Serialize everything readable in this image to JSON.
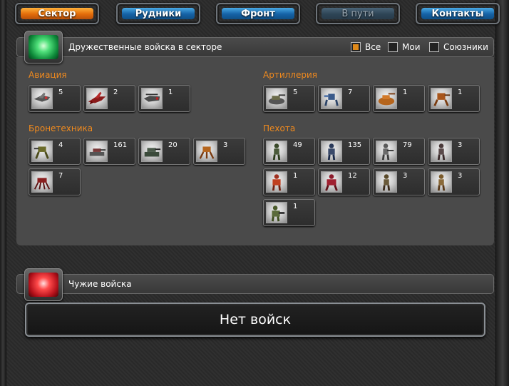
{
  "tabs": [
    {
      "label": "Сектор",
      "state": "active"
    },
    {
      "label": "Рудники",
      "state": "normal"
    },
    {
      "label": "Фронт",
      "state": "normal"
    },
    {
      "label": "В пути",
      "state": "disabled"
    },
    {
      "label": "Контакты",
      "state": "normal"
    }
  ],
  "friendly": {
    "title": "Дружественные войска в секторе",
    "filters": [
      {
        "label": "Все",
        "checked": true
      },
      {
        "label": "Мои",
        "checked": false
      },
      {
        "label": "Союзники",
        "checked": false
      }
    ],
    "groups": {
      "aviation": {
        "title": "Авиация",
        "counts": [
          "5",
          "2",
          "1"
        ]
      },
      "artillery": {
        "title": "Артиллерия",
        "counts": [
          "5",
          "7",
          "1",
          "1"
        ]
      },
      "armor": {
        "title": "Бронетехника",
        "counts": [
          "4",
          "161",
          "20",
          "3",
          "7"
        ]
      },
      "infantry": {
        "title": "Пехота",
        "counts": [
          "49",
          "135",
          "79",
          "3",
          "1",
          "12",
          "3",
          "3",
          "1"
        ]
      }
    }
  },
  "enemy": {
    "title": "Чужие войска",
    "empty_text": "Нет войск"
  },
  "colors": {
    "active_tab": "#e36c0a",
    "tab": "#1562a6",
    "group_title": "#f08a1e",
    "friendly_gem": "#2fcf5f",
    "enemy_gem": "#e02020"
  }
}
